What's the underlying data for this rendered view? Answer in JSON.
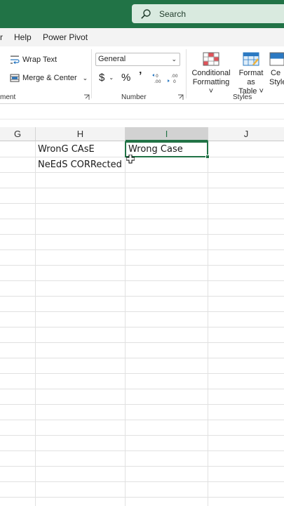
{
  "titlebar": {
    "search_placeholder": "Search",
    "icon": "search-icon"
  },
  "menu": {
    "items": [
      "r",
      "Help",
      "Power Pivot"
    ]
  },
  "ribbon": {
    "alignment": {
      "wrap_text": "Wrap Text",
      "merge_center": "Merge & Center",
      "group_label": "ment"
    },
    "number": {
      "format": "General",
      "currency": "$",
      "percent": "%",
      "comma": "͗",
      "group_label": "Number"
    },
    "styles": {
      "conditional_formatting": [
        "Conditional",
        "Formatting ˅"
      ],
      "format_as_table": [
        "Format as",
        "Table ˅"
      ],
      "cell_styles": [
        "Ce",
        "Style"
      ],
      "group_label": "Styles"
    }
  },
  "grid": {
    "columns": [
      "G",
      "H",
      "I",
      "J"
    ],
    "selected_column": "I",
    "cells": {
      "H1": "WronG CAsE",
      "H2": "NeEdS CORRected",
      "I1": "Wrong Case"
    }
  },
  "colors": {
    "accent": "#217346",
    "search_bg": "#d9eadf"
  }
}
